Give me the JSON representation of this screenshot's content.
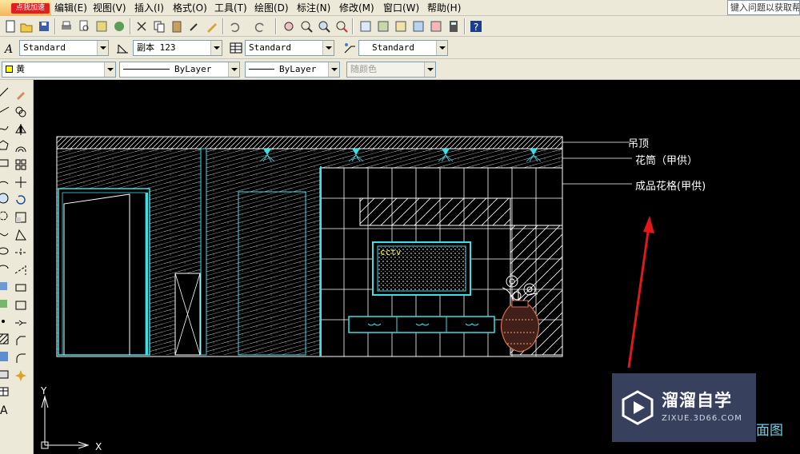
{
  "logo": {
    "badge_text": "点我加速"
  },
  "menu": [
    {
      "label": "编辑(E)"
    },
    {
      "label": "视图(V)"
    },
    {
      "label": "插入(I)"
    },
    {
      "label": "格式(O)"
    },
    {
      "label": "工具(T)"
    },
    {
      "label": "绘图(D)"
    },
    {
      "label": "标注(N)"
    },
    {
      "label": "修改(M)"
    },
    {
      "label": "窗口(W)"
    },
    {
      "label": "帮助(H)"
    }
  ],
  "help_search": {
    "placeholder": "键入问题以获取帮"
  },
  "styles_toolbar": {
    "text_style": "Standard",
    "dim_style": "副本 123",
    "table_style": "Standard",
    "multileader_style": "Standard"
  },
  "properties_toolbar": {
    "color": "黄",
    "linetype": "ByLayer",
    "lineweight": "ByLayer",
    "plot_style": "随颜色"
  },
  "drawing": {
    "labels": {
      "ceiling": "吊顶",
      "flower_tube": "花筒（甲供）",
      "lattice": "成品花格(甲供)",
      "tv_text": "cctv"
    },
    "partial_title": "面图",
    "ucs": {
      "y": "Y",
      "x": "X"
    }
  },
  "watermark": {
    "title": "溜溜自学",
    "url": "ZIXUE.3D66.COM"
  },
  "colors": {
    "cyan": "#38e0e8",
    "white": "#ffffff",
    "red_arrow": "#e01818",
    "yellow": "#ffff00"
  }
}
